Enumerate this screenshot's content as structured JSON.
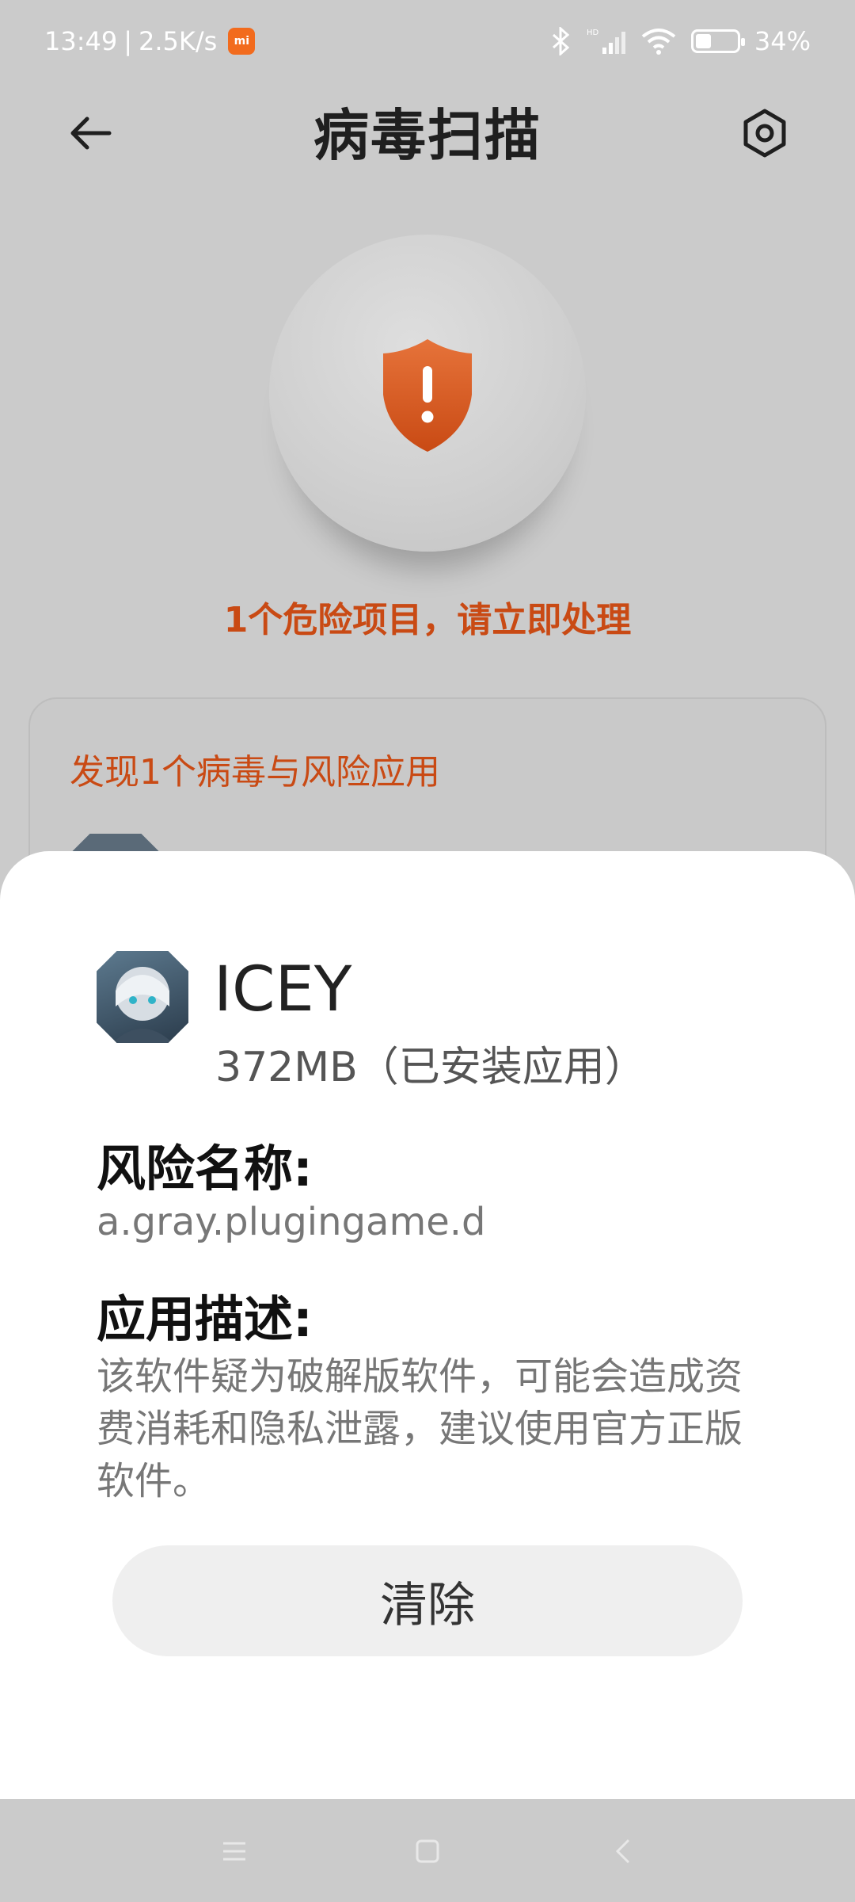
{
  "status_bar": {
    "time": "13:49",
    "speed": "2.5K/s",
    "mi_label": "mi",
    "battery_percent": "34%"
  },
  "header": {
    "title": "病毒扫描"
  },
  "scan": {
    "danger_text": "1个危险项目，请立即处理",
    "accent_color": "#d9541c"
  },
  "result_card": {
    "title": "发现1个病毒与风险应用"
  },
  "detail": {
    "app_name": "ICEY",
    "app_size": "372MB（已安装应用）",
    "risk_name_label": "风险名称:",
    "risk_name": "a.gray.plugingame.d",
    "description_label": "应用描述:",
    "description": "该软件疑为破解版软件，可能会造成资费消耗和隐私泄露，建议使用官方正版软件。",
    "clear_button": "清除"
  },
  "icons": {
    "back": "back-arrow-icon",
    "settings": "settings-icon",
    "shield": "shield-warning-icon",
    "nav_menu": "menu-icon",
    "nav_home": "home-icon",
    "nav_back": "back-icon"
  }
}
